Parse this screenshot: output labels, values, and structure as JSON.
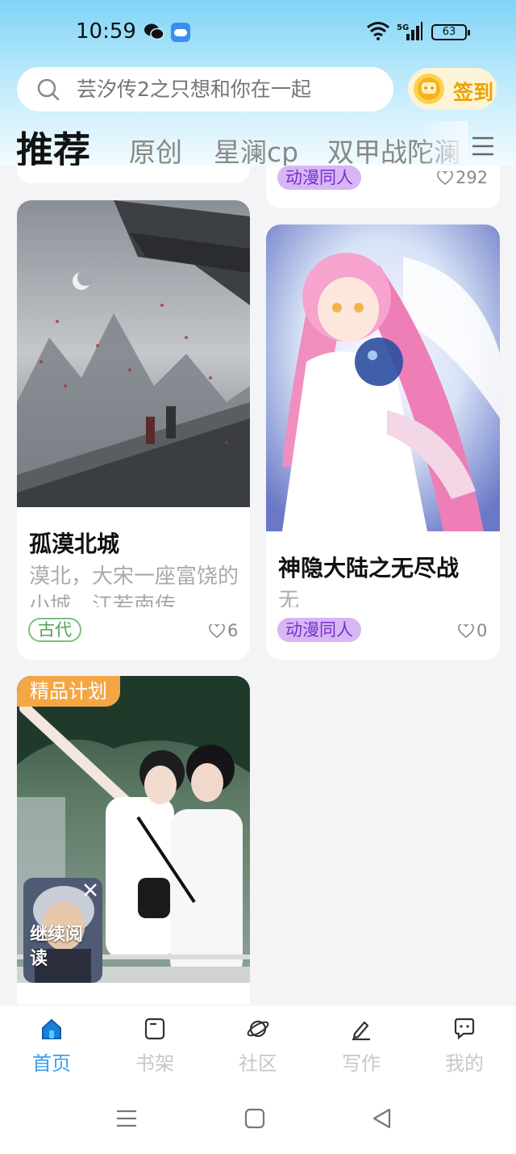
{
  "status_bar": {
    "time": "10:59",
    "battery": "63"
  },
  "search": {
    "placeholder": "芸汐传2之只想和你在一起"
  },
  "checkin": {
    "label": "签到"
  },
  "tabs": [
    {
      "label": "推荐"
    },
    {
      "label": "原创"
    },
    {
      "label": "星澜cp"
    },
    {
      "label": "双甲战陀澜"
    }
  ],
  "feed": {
    "partial_top_card": {
      "tag": "动漫同人",
      "likes": "292"
    },
    "cards": [
      {
        "title": "孤漠北城",
        "desc": "漠北，大宋一座富饶的小城，江若南传",
        "tag": "古代",
        "likes": "6"
      },
      {
        "title": "神隐大陆之无尽战",
        "desc": "无",
        "tag": "动漫同人",
        "likes": "0"
      },
      {
        "badge": "精品计划"
      }
    ],
    "continue_reading": "继续阅读"
  },
  "bottom_nav": [
    {
      "label": "首页",
      "active": true
    },
    {
      "label": "书架"
    },
    {
      "label": "社区"
    },
    {
      "label": "写作"
    },
    {
      "label": "我的"
    }
  ],
  "colors": {
    "accent": "#3aa0f0",
    "checkin": "#e8a300",
    "tag_purple": "#d6b7f4",
    "premium": "#f4a645"
  }
}
